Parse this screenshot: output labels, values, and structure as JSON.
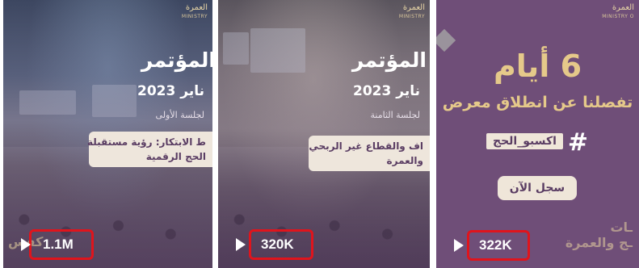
{
  "tiles": [
    {
      "id": "video-1",
      "ministry": "العمرة",
      "ministry_en": "MINISTRY",
      "title": "المؤتمر",
      "date": "ناير 2023",
      "session": "لجلسة الأولى",
      "banner_line1": "ط الابتكار: رؤية مستقبلة",
      "banner_line2": "الحج الرقمية",
      "footer": "كفس",
      "view_count": "1.1M"
    },
    {
      "id": "video-2",
      "ministry": "العمرة",
      "ministry_en": "MINISTRY",
      "title": "المؤتمر",
      "date": "ناير 2023",
      "session": "لجلسة الثامنة",
      "banner_line1": "اف والقطاع غير الربحي",
      "banner_line2": "والعمرة",
      "footer": "",
      "view_count": "320K"
    },
    {
      "id": "video-3",
      "ministry": "العمرة",
      "ministry_en": "MINISTRY O",
      "big_text": "6 أيام",
      "subline": "تفصلنا عن انطلاق معرض",
      "hashtag": "اكسبو_الحج",
      "cta": "سجل الآن",
      "footer_line1": "ـات",
      "footer_line2": "ـج والعمرة",
      "view_count": "322K"
    }
  ],
  "colors": {
    "highlight_border": "#e0141c",
    "gold_text": "#e5c98a",
    "purple_bg": "#6f4e78",
    "banner_bg": "#eee6dc"
  }
}
